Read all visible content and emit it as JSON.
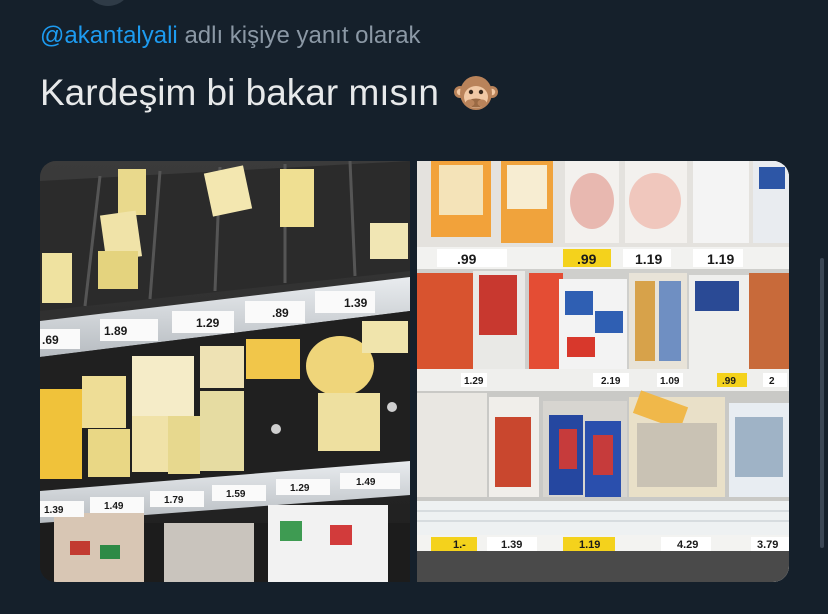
{
  "reply": {
    "mention": "@akantalyali",
    "suffix": "adlı kişiye yanıt olarak"
  },
  "tweet": {
    "text": "Kardeşim bi bakar mısın",
    "emoji": "speak-no-evil-monkey-icon"
  },
  "left_photo": {
    "price_tags_top": [
      ".69",
      "1.89",
      "1.29",
      ".89",
      "1.39"
    ],
    "price_tags_bottom": [
      "1.39",
      "1.49",
      "1.79",
      "1.59",
      "1.29",
      "1.49"
    ]
  },
  "right_photo": {
    "price_tags_top": [
      ".99",
      ".99",
      "1.19",
      "1.19"
    ],
    "price_tags_mid": [
      "1.29",
      "2.19",
      "1.09",
      ".99",
      "2"
    ],
    "price_tags_bottom": [
      "1.-",
      "1.39",
      "1.19",
      "4.29",
      "3.79"
    ]
  },
  "colors": {
    "background": "#15202b",
    "mention": "#1d9bf0",
    "muted_text": "#8b98a5",
    "main_text": "#e7e9ea"
  }
}
